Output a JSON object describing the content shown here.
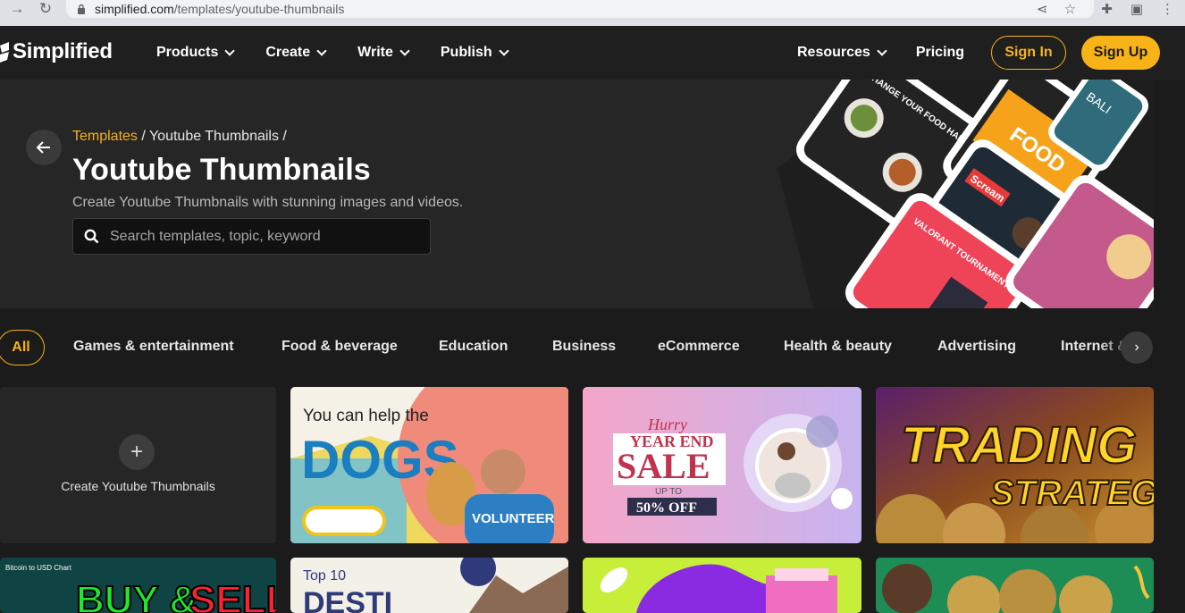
{
  "browser": {
    "url_domain": "simplified.com",
    "url_path": "/templates/youtube-thumbnails"
  },
  "header": {
    "logo_text": "Simplified",
    "nav": [
      "Products",
      "Create",
      "Write",
      "Publish"
    ],
    "resources_label": "Resources",
    "pricing_label": "Pricing",
    "signin_label": "Sign In",
    "signup_label": "Sign Up"
  },
  "hero": {
    "breadcrumb_link": "Templates",
    "breadcrumb_rest": " / Youtube Thumbnails /",
    "title": "Youtube Thumbnails",
    "subtitle": "Create Youtube Thumbnails with stunning images and videos.",
    "search_placeholder": "Search templates, topic, keyword",
    "art_texts": {
      "food_headline": "CHANGE YOUR FOOD HABITS TODAY",
      "food_brand": "FOOD",
      "scream": "Scream",
      "valorant": "VALORANT TOURNAMENT HIGHLIGHTS",
      "ball": "BALI"
    }
  },
  "categories": {
    "active": "All",
    "items": [
      "Games & entertainment",
      "Food & beverage",
      "Education",
      "Business",
      "eCommerce",
      "Health & beauty",
      "Advertising",
      "Internet & te"
    ]
  },
  "create_card": {
    "label": "Create Youtube Thumbnails"
  },
  "thumbnails": {
    "dogs": {
      "line1": "You can help the",
      "big": "DOGS",
      "badge": "VOLUNTEER"
    },
    "sale": {
      "hurry": "Hurry",
      "year_end": "YEAR END",
      "sale": "SALE",
      "upto": "UP TO",
      "off": "50% OFF"
    },
    "trading": {
      "line1": "TRADING",
      "line2": "STRATEGY"
    },
    "buysell": {
      "small": "Bitcoin to USD Chart",
      "big_left": "BUY &",
      "big_right": "SELL"
    },
    "top10": {
      "line1": "Top 10",
      "line2": "DESTI"
    }
  },
  "colors": {
    "accent": "#f8b318",
    "bg": "#1b1b1b",
    "hero_bg": "#262626"
  }
}
